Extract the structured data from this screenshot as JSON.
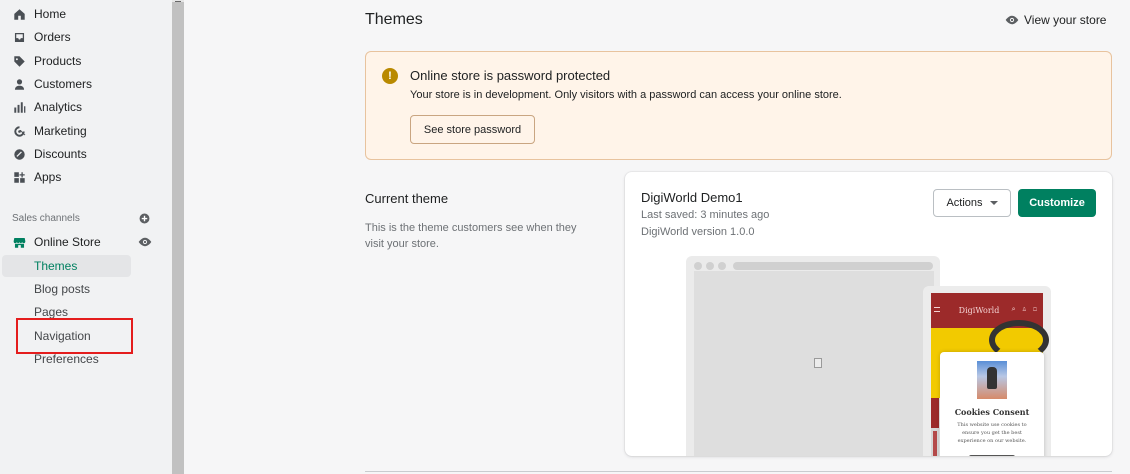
{
  "sidebar": {
    "items": [
      {
        "label": "Home",
        "icon": "home-icon"
      },
      {
        "label": "Orders",
        "icon": "orders-icon"
      },
      {
        "label": "Products",
        "icon": "tag-icon"
      },
      {
        "label": "Customers",
        "icon": "person-icon"
      },
      {
        "label": "Analytics",
        "icon": "bar-chart-icon"
      },
      {
        "label": "Marketing",
        "icon": "target-icon"
      },
      {
        "label": "Discounts",
        "icon": "discount-icon"
      },
      {
        "label": "Apps",
        "icon": "apps-icon"
      }
    ],
    "sales_channels_label": "Sales channels",
    "online_store_label": "Online Store",
    "subitems": [
      {
        "label": "Themes",
        "active": true
      },
      {
        "label": "Blog posts",
        "active": false
      },
      {
        "label": "Pages",
        "active": false
      },
      {
        "label": "Navigation",
        "active": false
      },
      {
        "label": "Preferences",
        "active": false
      }
    ]
  },
  "header": {
    "title": "Themes",
    "view_store_label": "View your store"
  },
  "banner": {
    "title": "Online store is password protected",
    "text": "Your store is in development. Only visitors with a password can access your online store.",
    "button_label": "See store password",
    "icon": "!"
  },
  "current_theme": {
    "heading": "Current theme",
    "description": "This is the theme customers see when they visit your store.",
    "name": "DigiWorld Demo1",
    "last_saved": "Last saved: 3 minutes ago",
    "version": "DigiWorld version 1.0.0",
    "actions_label": "Actions",
    "customize_label": "Customize"
  },
  "preview": {
    "brand": "DigiWorld",
    "header_icons": "⌕ ♙ ◻",
    "cookie_title": "Cookies Consent",
    "cookie_text": "This website use cookies to ensure you get the best experience on our website."
  },
  "colors": {
    "accent": "#008060",
    "highlight": "#e41d1d",
    "banner_bg": "#fff4e9",
    "preview_header": "#9c2a2a",
    "preview_hero": "#f2ca00"
  }
}
